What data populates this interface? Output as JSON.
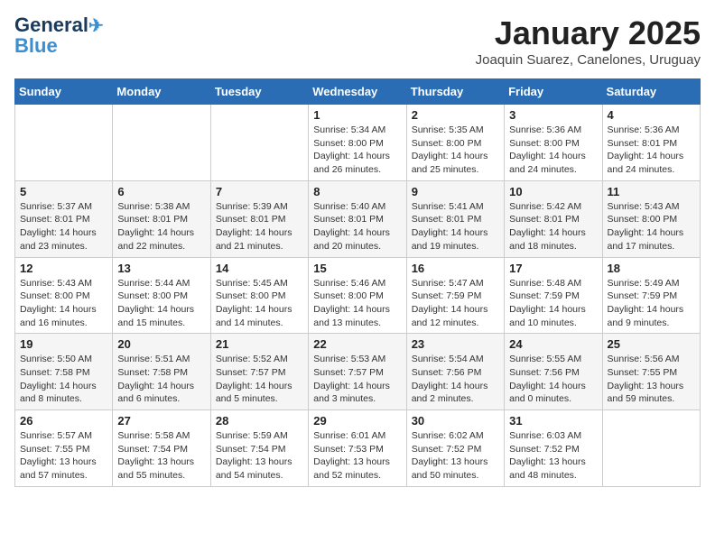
{
  "header": {
    "logo_line1": "General",
    "logo_line2": "Blue",
    "title": "January 2025",
    "subtitle": "Joaquin Suarez, Canelones, Uruguay"
  },
  "weekdays": [
    "Sunday",
    "Monday",
    "Tuesday",
    "Wednesday",
    "Thursday",
    "Friday",
    "Saturday"
  ],
  "weeks": [
    [
      {
        "day": "",
        "info": ""
      },
      {
        "day": "",
        "info": ""
      },
      {
        "day": "",
        "info": ""
      },
      {
        "day": "1",
        "info": "Sunrise: 5:34 AM\nSunset: 8:00 PM\nDaylight: 14 hours\nand 26 minutes."
      },
      {
        "day": "2",
        "info": "Sunrise: 5:35 AM\nSunset: 8:00 PM\nDaylight: 14 hours\nand 25 minutes."
      },
      {
        "day": "3",
        "info": "Sunrise: 5:36 AM\nSunset: 8:00 PM\nDaylight: 14 hours\nand 24 minutes."
      },
      {
        "day": "4",
        "info": "Sunrise: 5:36 AM\nSunset: 8:01 PM\nDaylight: 14 hours\nand 24 minutes."
      }
    ],
    [
      {
        "day": "5",
        "info": "Sunrise: 5:37 AM\nSunset: 8:01 PM\nDaylight: 14 hours\nand 23 minutes."
      },
      {
        "day": "6",
        "info": "Sunrise: 5:38 AM\nSunset: 8:01 PM\nDaylight: 14 hours\nand 22 minutes."
      },
      {
        "day": "7",
        "info": "Sunrise: 5:39 AM\nSunset: 8:01 PM\nDaylight: 14 hours\nand 21 minutes."
      },
      {
        "day": "8",
        "info": "Sunrise: 5:40 AM\nSunset: 8:01 PM\nDaylight: 14 hours\nand 20 minutes."
      },
      {
        "day": "9",
        "info": "Sunrise: 5:41 AM\nSunset: 8:01 PM\nDaylight: 14 hours\nand 19 minutes."
      },
      {
        "day": "10",
        "info": "Sunrise: 5:42 AM\nSunset: 8:01 PM\nDaylight: 14 hours\nand 18 minutes."
      },
      {
        "day": "11",
        "info": "Sunrise: 5:43 AM\nSunset: 8:00 PM\nDaylight: 14 hours\nand 17 minutes."
      }
    ],
    [
      {
        "day": "12",
        "info": "Sunrise: 5:43 AM\nSunset: 8:00 PM\nDaylight: 14 hours\nand 16 minutes."
      },
      {
        "day": "13",
        "info": "Sunrise: 5:44 AM\nSunset: 8:00 PM\nDaylight: 14 hours\nand 15 minutes."
      },
      {
        "day": "14",
        "info": "Sunrise: 5:45 AM\nSunset: 8:00 PM\nDaylight: 14 hours\nand 14 minutes."
      },
      {
        "day": "15",
        "info": "Sunrise: 5:46 AM\nSunset: 8:00 PM\nDaylight: 14 hours\nand 13 minutes."
      },
      {
        "day": "16",
        "info": "Sunrise: 5:47 AM\nSunset: 7:59 PM\nDaylight: 14 hours\nand 12 minutes."
      },
      {
        "day": "17",
        "info": "Sunrise: 5:48 AM\nSunset: 7:59 PM\nDaylight: 14 hours\nand 10 minutes."
      },
      {
        "day": "18",
        "info": "Sunrise: 5:49 AM\nSunset: 7:59 PM\nDaylight: 14 hours\nand 9 minutes."
      }
    ],
    [
      {
        "day": "19",
        "info": "Sunrise: 5:50 AM\nSunset: 7:58 PM\nDaylight: 14 hours\nand 8 minutes."
      },
      {
        "day": "20",
        "info": "Sunrise: 5:51 AM\nSunset: 7:58 PM\nDaylight: 14 hours\nand 6 minutes."
      },
      {
        "day": "21",
        "info": "Sunrise: 5:52 AM\nSunset: 7:57 PM\nDaylight: 14 hours\nand 5 minutes."
      },
      {
        "day": "22",
        "info": "Sunrise: 5:53 AM\nSunset: 7:57 PM\nDaylight: 14 hours\nand 3 minutes."
      },
      {
        "day": "23",
        "info": "Sunrise: 5:54 AM\nSunset: 7:56 PM\nDaylight: 14 hours\nand 2 minutes."
      },
      {
        "day": "24",
        "info": "Sunrise: 5:55 AM\nSunset: 7:56 PM\nDaylight: 14 hours\nand 0 minutes."
      },
      {
        "day": "25",
        "info": "Sunrise: 5:56 AM\nSunset: 7:55 PM\nDaylight: 13 hours\nand 59 minutes."
      }
    ],
    [
      {
        "day": "26",
        "info": "Sunrise: 5:57 AM\nSunset: 7:55 PM\nDaylight: 13 hours\nand 57 minutes."
      },
      {
        "day": "27",
        "info": "Sunrise: 5:58 AM\nSunset: 7:54 PM\nDaylight: 13 hours\nand 55 minutes."
      },
      {
        "day": "28",
        "info": "Sunrise: 5:59 AM\nSunset: 7:54 PM\nDaylight: 13 hours\nand 54 minutes."
      },
      {
        "day": "29",
        "info": "Sunrise: 6:01 AM\nSunset: 7:53 PM\nDaylight: 13 hours\nand 52 minutes."
      },
      {
        "day": "30",
        "info": "Sunrise: 6:02 AM\nSunset: 7:52 PM\nDaylight: 13 hours\nand 50 minutes."
      },
      {
        "day": "31",
        "info": "Sunrise: 6:03 AM\nSunset: 7:52 PM\nDaylight: 13 hours\nand 48 minutes."
      },
      {
        "day": "",
        "info": ""
      }
    ]
  ]
}
